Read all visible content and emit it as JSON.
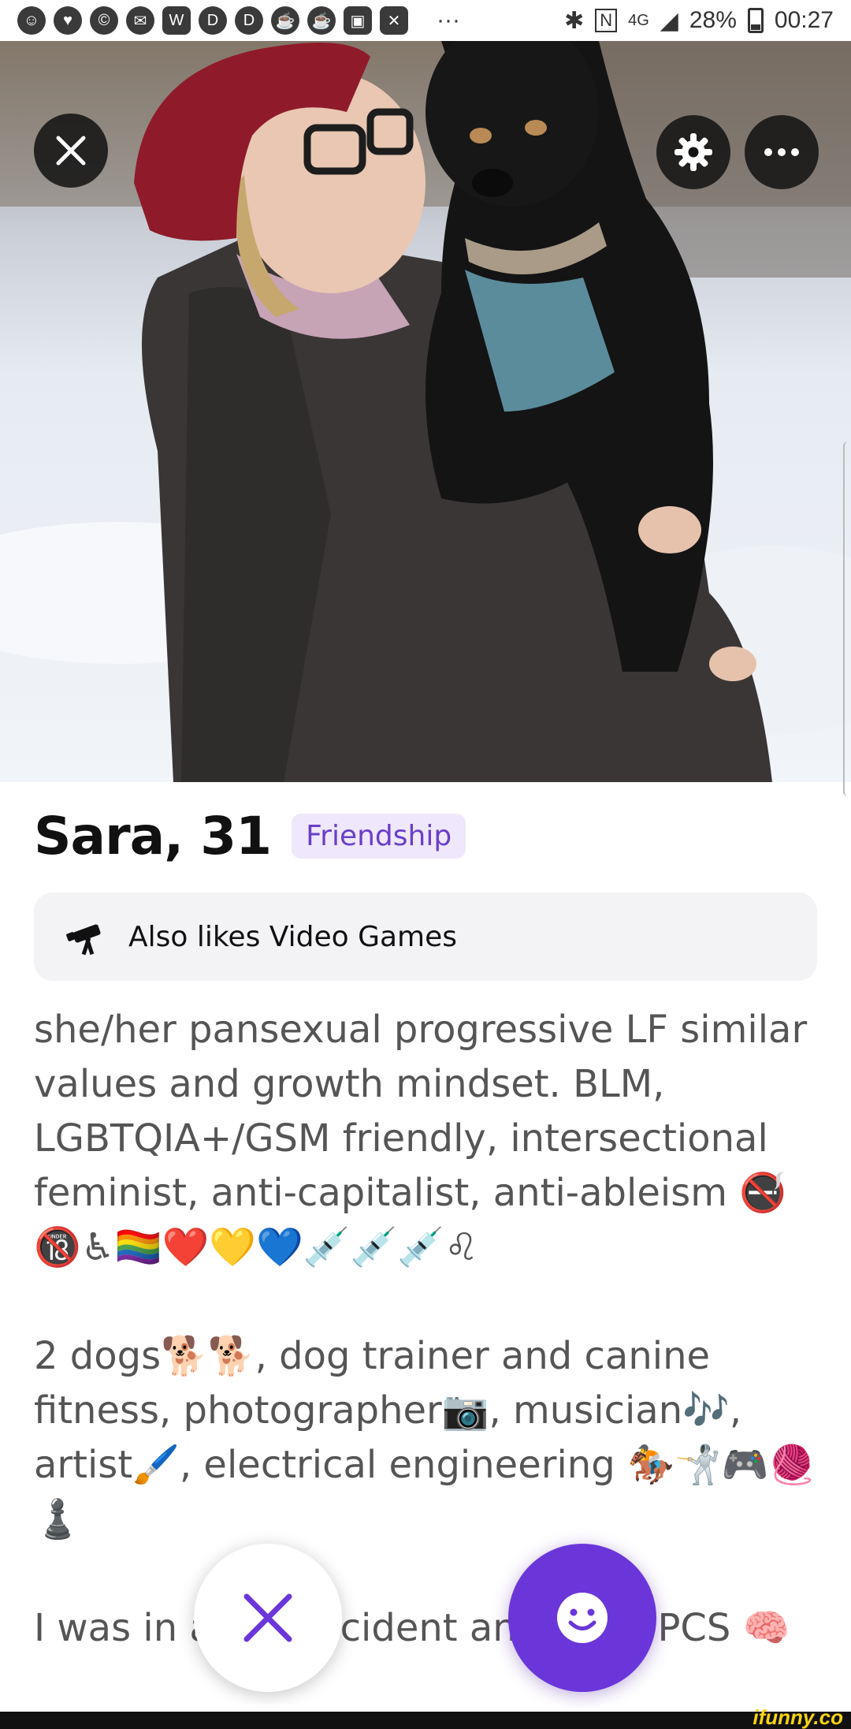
{
  "status_bar": {
    "notification_icons": [
      "face-icon",
      "heart-icon",
      "c-icon",
      "chat-icon",
      "webtoon-icon",
      "d-icon",
      "d-icon",
      "cup-icon",
      "cup-icon",
      "twitch-icon",
      "x-icon"
    ],
    "overflow": "···",
    "network": "4G",
    "battery_percent": "28%",
    "time": "00:27"
  },
  "profile": {
    "name_age": "Sara, 31",
    "badge": "Friendship",
    "also_likes": "Also likes Video Games",
    "bio": [
      "she/her pansexual progressive LF similar values and growth mindset. BLM, LGBTQIA+/GSM friendly, intersectional feminist, anti-capitalist, anti-ableism 🚭🔞♿🏳️‍🌈❤️💛💙💉💉💉♌",
      "2 dogs🐕🐕, dog trainer and canine fitness, photographer📷, musician🎶, artist🖌️, electrical engineering 🏇🤺🎮🧶♟️",
      "I was in a car accident and have PCS 🧠"
    ]
  },
  "watermark": "ifunny.co",
  "colors": {
    "accent": "#6b36d9",
    "badge_bg": "#efe7fb",
    "badge_text": "#6a3fc9"
  }
}
